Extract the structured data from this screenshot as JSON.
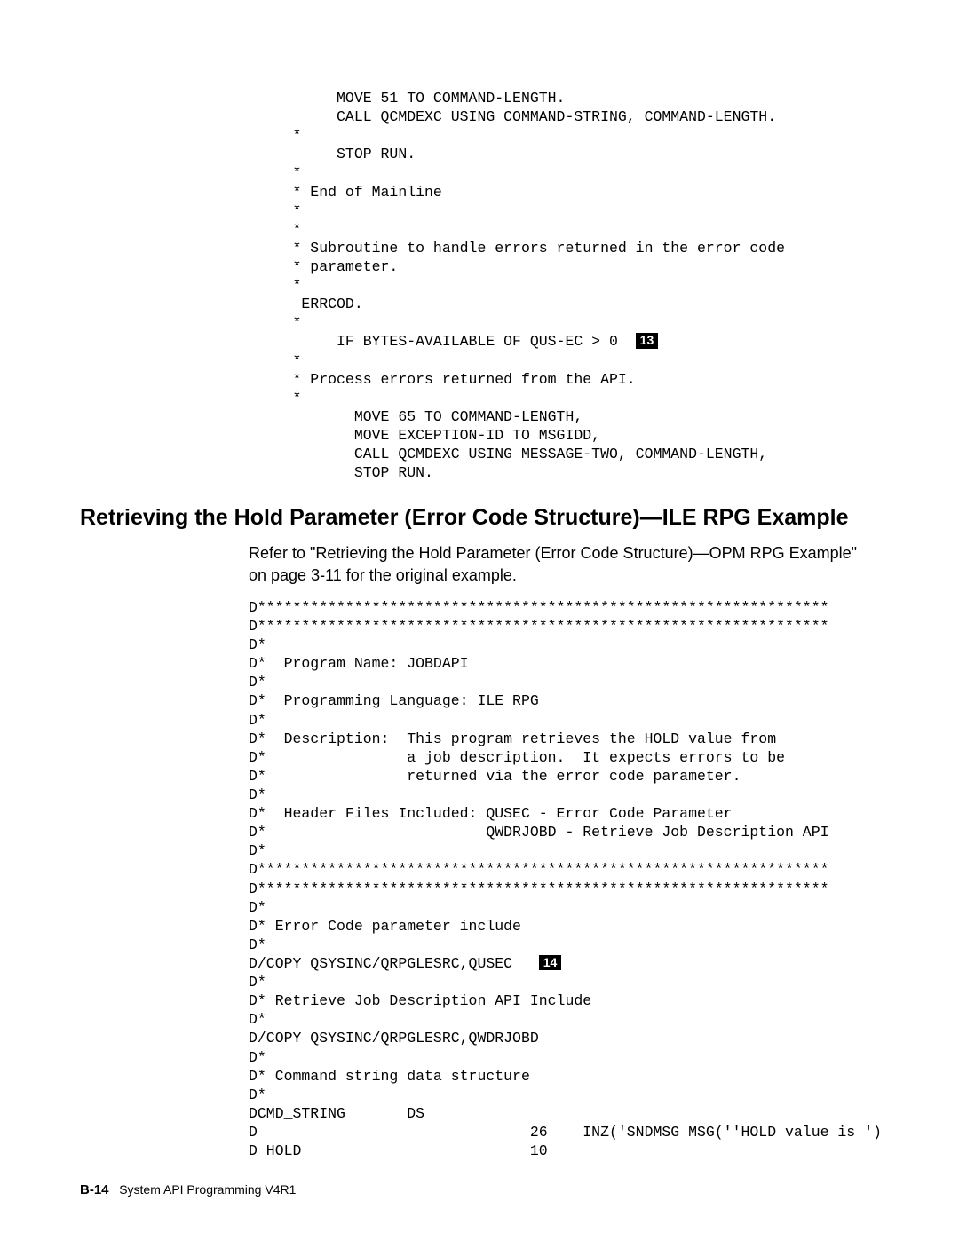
{
  "code1": {
    "l1": "          MOVE 51 TO COMMAND-LENGTH.",
    "l2": "          CALL QCMDEXC USING COMMAND-STRING, COMMAND-LENGTH.",
    "l3": "     *",
    "l4": "          STOP RUN.",
    "l5": "     *",
    "l6": "     * End of Mainline",
    "l7": "     *",
    "l8": "     *",
    "l9": "     * Subroutine to handle errors returned in the error code",
    "l10": "     * parameter.",
    "l11": "     *",
    "l12": "      ERRCOD.",
    "l13": "     *",
    "l14a": "          IF BYTES-AVAILABLE OF QUS-EC > 0  ",
    "l15": "     *",
    "l16": "     * Process errors returned from the API.",
    "l17": "     *",
    "l18": "            MOVE 65 TO COMMAND-LENGTH,",
    "l19": "            MOVE EXCEPTION-ID TO MSGIDD,",
    "l20": "            CALL QCMDEXC USING MESSAGE-TWO, COMMAND-LENGTH,",
    "l21": "            STOP RUN."
  },
  "callout1": "13",
  "heading": "Retrieving the Hold Parameter (Error Code Structure)—ILE RPG Example",
  "body1": "Refer to \"Retrieving the Hold Parameter (Error Code Structure)—OPM RPG Example\" on page 3-11 for the original example.",
  "code2": {
    "l1": "D*****************************************************************",
    "l2": "D*****************************************************************",
    "l3": "D*",
    "l4": "D*  Program Name: JOBDAPI",
    "l5": "D*",
    "l6": "D*  Programming Language: ILE RPG",
    "l7": "D*",
    "l8": "D*  Description:  This program retrieves the HOLD value from",
    "l9": "D*                a job description.  It expects errors to be",
    "l10": "D*                returned via the error code parameter.",
    "l11": "D*",
    "l12": "D*  Header Files Included: QUSEC - Error Code Parameter",
    "l13": "D*                         QWDRJOBD - Retrieve Job Description API",
    "l14": "D*",
    "l15": "D*****************************************************************",
    "l16": "D*****************************************************************",
    "l17": "D*",
    "l18": "D* Error Code parameter include",
    "l19": "D*",
    "l20a": "D/COPY QSYSINC/QRPGLESRC,QUSEC   ",
    "l21": "D*",
    "l22": "D* Retrieve Job Description API Include",
    "l23": "D*",
    "l24": "D/COPY QSYSINC/QRPGLESRC,QWDRJOBD",
    "l25": "D*",
    "l26": "D* Command string data structure",
    "l27": "D*",
    "l28": "DCMD_STRING       DS",
    "l29": "D                               26    INZ('SNDMSG MSG(''HOLD value is ')",
    "l30": "D HOLD                          10"
  },
  "callout2": "14",
  "footer": {
    "page": "B-14",
    "text": "System API Programming V4R1"
  }
}
